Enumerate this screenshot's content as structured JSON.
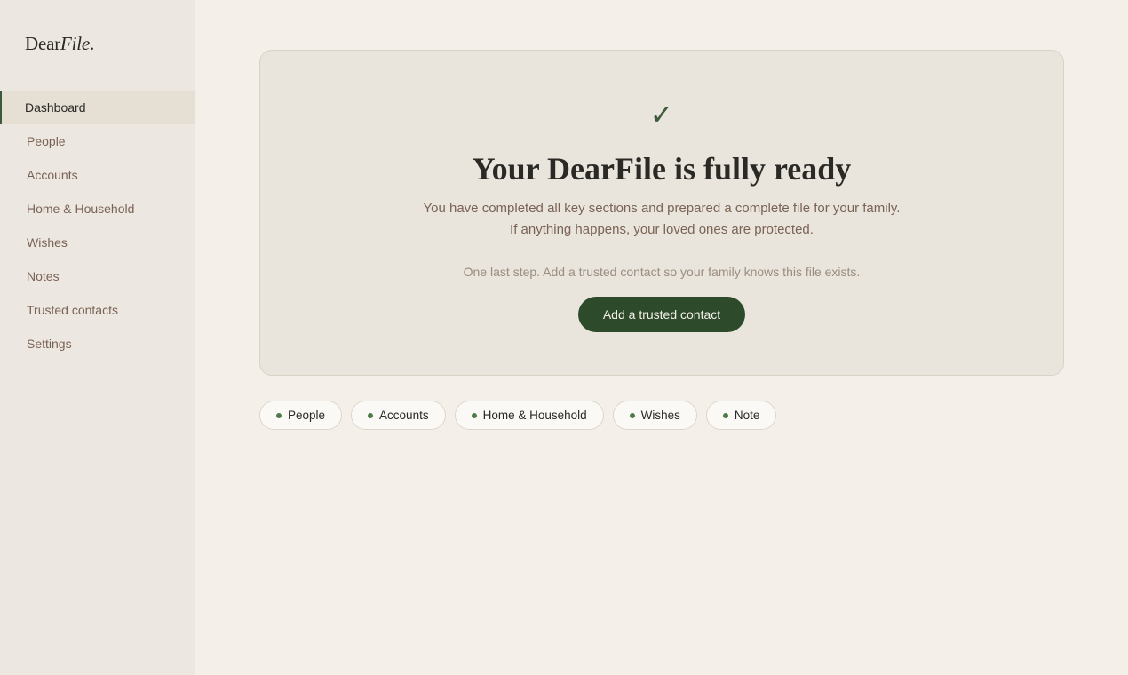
{
  "brand": {
    "name_regular": "Dear",
    "name_italic": "File",
    "suffix": "."
  },
  "sidebar": {
    "items": [
      {
        "label": "Dashboard",
        "active": true
      },
      {
        "label": "People"
      },
      {
        "label": "Accounts"
      },
      {
        "label": "Home & Household"
      },
      {
        "label": "Wishes"
      },
      {
        "label": "Notes"
      },
      {
        "label": "Trusted contacts"
      },
      {
        "label": "Settings"
      }
    ]
  },
  "card": {
    "icon": "check-icon",
    "icon_glyph": "✓",
    "title": "Your DearFile is fully ready",
    "desc_line1": "You have completed all key sections and prepared a complete file for your family.",
    "desc_line2": "If anything happens, your loved ones are protected.",
    "note": "One last step. Add a trusted contact so your family knows this file exists.",
    "cta_label": "Add a trusted contact"
  },
  "chips": [
    {
      "label": "People"
    },
    {
      "label": "Accounts"
    },
    {
      "label": "Home & Household"
    },
    {
      "label": "Wishes"
    },
    {
      "label": "Note"
    }
  ],
  "colors": {
    "accent": "#2d4a2b",
    "dot": "#4f7a4a",
    "background": "#f4f0e9",
    "sidebar": "#ece7e0"
  }
}
